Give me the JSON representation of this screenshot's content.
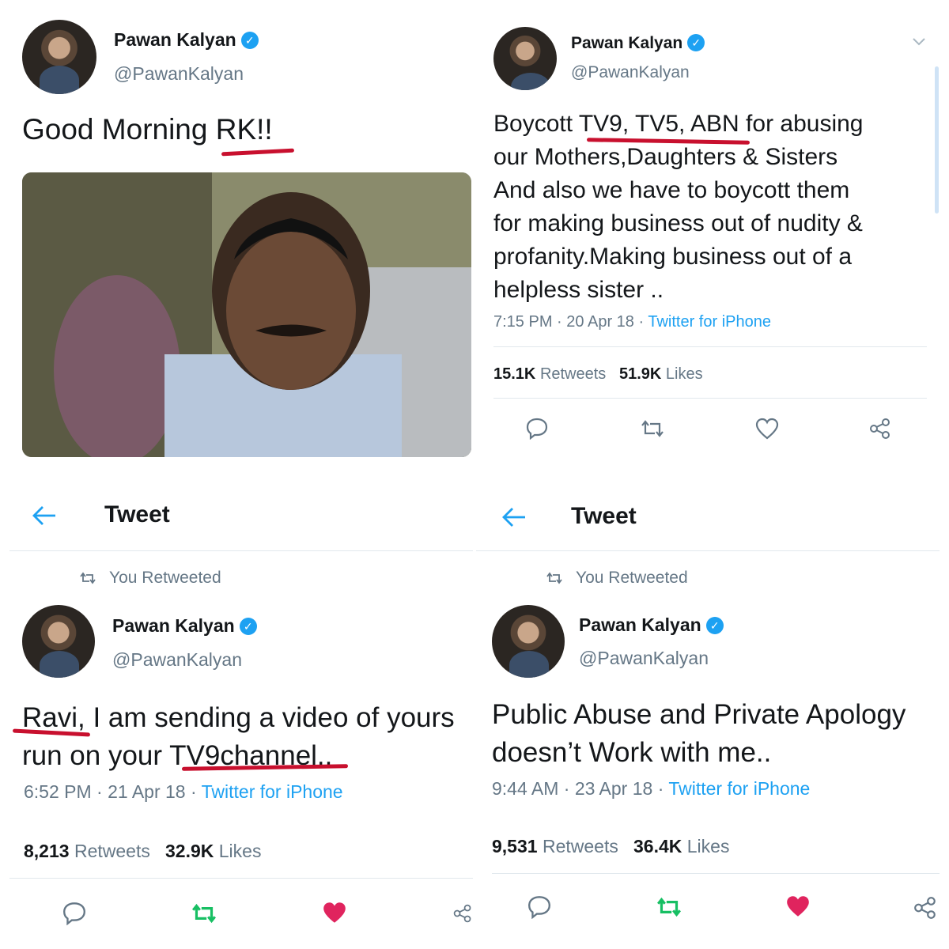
{
  "colors": {
    "accent": "#1da1f2",
    "text": "#14171a",
    "muted": "#657786",
    "like": "#e0245e",
    "retweet": "#17bf63",
    "underline": "#c8102e"
  },
  "panel1": {
    "name": "Pawan Kalyan",
    "handle": "@PawanKalyan",
    "text": "Good Morning RK!!",
    "image": "photo"
  },
  "panel2": {
    "name": "Pawan Kalyan",
    "handle": "@PawanKalyan",
    "lines": [
      "Boycott TV9, TV5, ABN  for abusing",
      "our Mothers,Daughters & Sisters",
      "And also we have to boycott them",
      "for making business out of nudity &",
      "profanity.Making business out of a",
      "helpless sister .."
    ],
    "time": "7:15 PM",
    "date": "20 Apr 18",
    "source": "Twitter for iPhone",
    "retweets": "15.1K",
    "retweets_label": "Retweets",
    "likes": "51.9K",
    "likes_label": "Likes"
  },
  "panel3": {
    "header_title": "Tweet",
    "rt_note": "You Retweeted",
    "name": "Pawan Kalyan",
    "handle": "@PawanKalyan",
    "line1": "Ravi, I am sending a video of yours",
    "line2": "run on your TV9channel..",
    "time": "6:52 PM",
    "date": "21 Apr 18",
    "source": "Twitter for iPhone",
    "retweets": "8,213",
    "retweets_label": "Retweets",
    "likes": "32.9K",
    "likes_label": "Likes"
  },
  "panel4": {
    "header_title": "Tweet",
    "rt_note": "You Retweeted",
    "name": "Pawan Kalyan",
    "handle": "@PawanKalyan",
    "line1": "Public Abuse and Private Apology",
    "line2": "doesn’t Work with me..",
    "time": "9:44 AM",
    "date": "23 Apr 18",
    "source": "Twitter for iPhone",
    "retweets": "9,531",
    "retweets_label": "Retweets",
    "likes": "36.4K",
    "likes_label": "Likes"
  },
  "sep": "·",
  "icons": {
    "verified": "verified-badge-icon",
    "reply": "reply-icon",
    "retweet": "retweet-icon",
    "like": "heart-icon",
    "share": "share-icon",
    "back": "back-arrow-icon",
    "chevron": "chevron-down-icon"
  }
}
